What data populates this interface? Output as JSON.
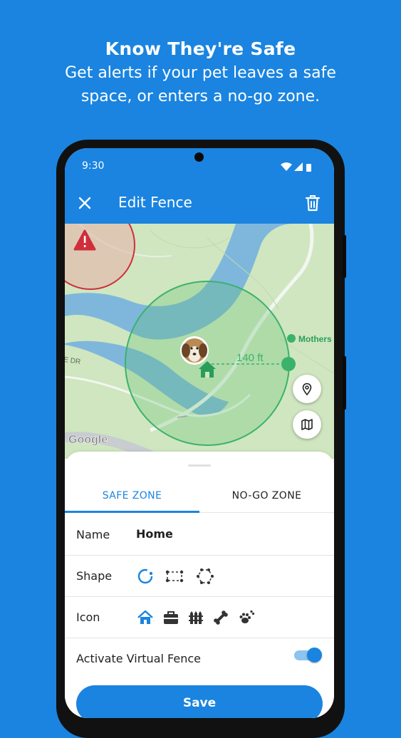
{
  "promo": {
    "title": "Know They're Safe",
    "subtitle_line1": "Get alerts if your pet leaves a safe",
    "subtitle_line2": "space, or enters a no-go zone."
  },
  "status_bar": {
    "time": "9:30"
  },
  "app_bar": {
    "title": "Edit Fence",
    "close_icon": "close-icon",
    "delete_icon": "trash-icon"
  },
  "map": {
    "distance_label": "140 ft",
    "poi_label": "Mothers",
    "road_label": "E DR",
    "attribution": "Google",
    "buttons": [
      "location-pin-icon",
      "map-layers-icon"
    ],
    "colors": {
      "water": "#7fb7dc",
      "land": "#cfe6c0",
      "safe_zone": "#3bb26a",
      "no_go_zone": "#cf2f3b"
    }
  },
  "sheet": {
    "tabs": [
      {
        "label": "SAFE ZONE",
        "active": true
      },
      {
        "label": "NO-GO ZONE",
        "active": false
      }
    ],
    "name_label": "Name",
    "name_value": "Home",
    "shape_label": "Shape",
    "shape_options": [
      "circle-shape-icon",
      "rectangle-shape-icon",
      "polygon-shape-icon"
    ],
    "shape_selected": "circle-shape-icon",
    "icon_label": "Icon",
    "icon_options": [
      "home-icon",
      "briefcase-icon",
      "fence-icon",
      "bone-icon",
      "paw-icon"
    ],
    "icon_selected": "home-icon",
    "activate_label": "Activate Virtual Fence",
    "activate_enabled": true,
    "save_label": "Save"
  },
  "accent_color": "#1a84e0"
}
